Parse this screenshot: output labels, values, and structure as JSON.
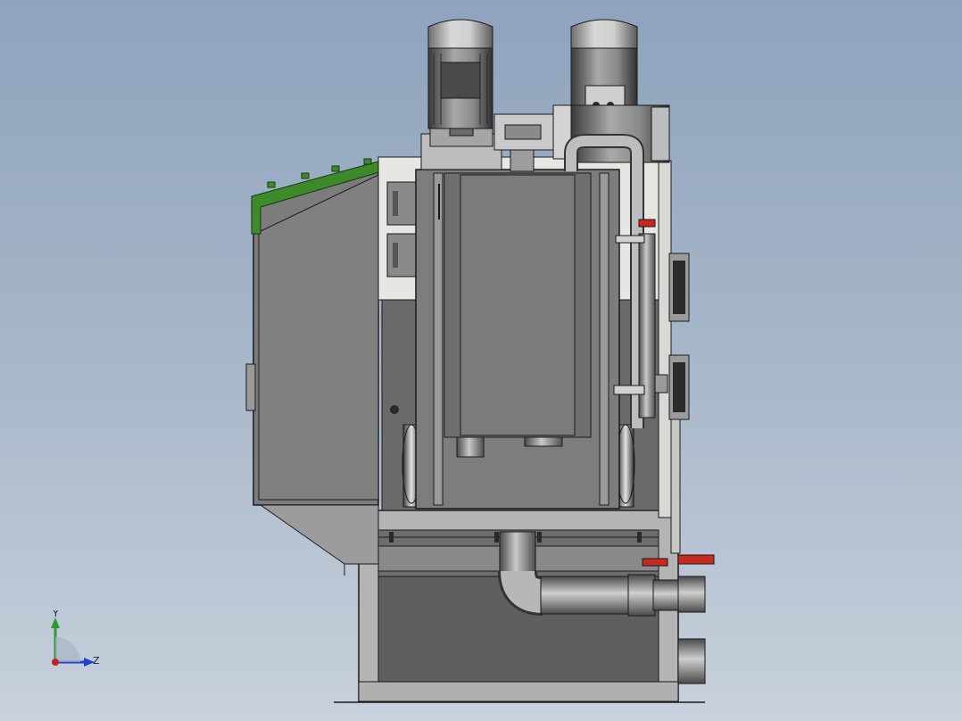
{
  "viewport": {
    "background_top": "#8fa3bd",
    "background_bottom": "#c8d1dc"
  },
  "model": {
    "description_colors": {
      "steel": "#7b7b7b",
      "steel_dark": "#5e5e5e",
      "steel_light": "#b9b9b9",
      "panel_white": "#e9e9e6",
      "green_trim": "#3d8a2a",
      "red_valve": "#c8281e",
      "outline": "#1a1a1a"
    }
  },
  "triad": {
    "y_label": "Y",
    "z_label": "Z",
    "y_color": "#2e9a2e",
    "z_color": "#2240c8",
    "x_color": "#c82020"
  }
}
